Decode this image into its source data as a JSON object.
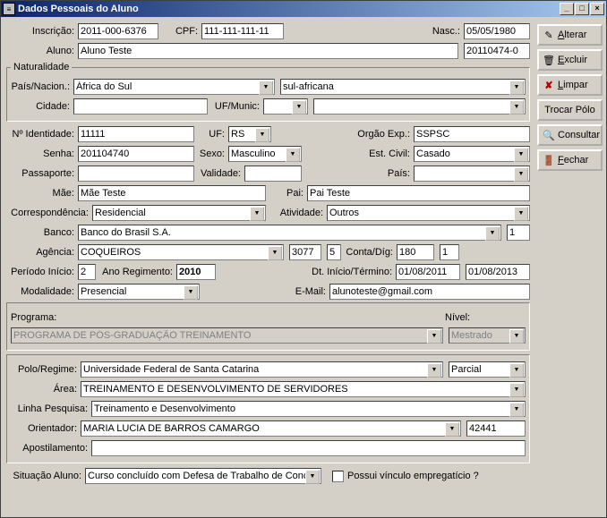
{
  "window": {
    "title": "Dados Pessoais do Aluno"
  },
  "buttons": {
    "alterar": "Alterar",
    "excluir": "Excluir",
    "limpar": "Limpar",
    "trocar_polo": "Trocar Pólo",
    "consultar": "Consultar",
    "fechar": "Fechar"
  },
  "labels": {
    "inscricao": "Inscrição:",
    "cpf": "CPF:",
    "nasc": "Nasc.:",
    "aluno": "Aluno:",
    "naturalidade_legend": "Naturalidade",
    "pais_nacion": "País/Nacion.:",
    "cidade": "Cidade:",
    "uf_munic": "UF/Munic:",
    "n_identidade": "Nº Identidade:",
    "uf": "UF:",
    "orgao_exp": "Orgão Exp.:",
    "senha": "Senha:",
    "sexo": "Sexo:",
    "est_civil": "Est. Civil:",
    "passaporte": "Passaporte:",
    "validade": "Validade:",
    "pais": "País:",
    "mae": "Mãe:",
    "pai": "Pai:",
    "correspondencia": "Correspondência:",
    "atividade": "Atividade:",
    "banco": "Banco:",
    "agencia": "Agência:",
    "conta_dig": "Conta/Díg:",
    "periodo_inicio": "Período Início:",
    "ano_regimento": "Ano Regimento:",
    "dt_inicio_termino": "Dt. Início/Término:",
    "modalidade": "Modalidade:",
    "email": "E-Mail:",
    "programa": "Programa:",
    "nivel": "Nível:",
    "polo_regime": "Polo/Regime:",
    "area": "Área:",
    "linha_pesquisa": "Linha Pesquisa:",
    "orientador": "Orientador:",
    "apostilamento": "Apostilamento:",
    "situacao_aluno": "Situação Aluno:",
    "possui_vinculo": "Possui vínculo empregatício ?"
  },
  "values": {
    "inscricao": "2011-000-6376",
    "cpf": "111-111-111-11",
    "nasc": "05/05/1980",
    "aluno": "Aluno Teste",
    "aluno_cod": "20110474-0",
    "pais": "África do Sul",
    "nacion": "sul-africana",
    "cidade": "",
    "uf_munic_uf": "",
    "uf_munic": "",
    "n_identidade": "11111",
    "uf": "RS",
    "orgao_exp": "SSPSC",
    "senha": "201104740",
    "sexo": "Masculino",
    "est_civil": "Casado",
    "passaporte": "",
    "validade": "",
    "pais_passaporte": "",
    "mae": "Mãe Teste",
    "pai": "Pai Teste",
    "correspondencia": "Residencial",
    "atividade": "Outros",
    "banco": "Banco do Brasil S.A.",
    "banco_cod": "1",
    "agencia": "COQUEIROS",
    "agencia_cod": "3077",
    "agencia_dig": "5",
    "conta": "180",
    "conta_dig": "1",
    "periodo_inicio": "2",
    "ano_regimento": "2010",
    "dt_inicio": "01/08/2011",
    "dt_termino": "01/08/2013",
    "modalidade": "Presencial",
    "email": "alunoteste@gmail.com",
    "programa": "PROGRAMA DE PÓS-GRADUAÇÃO TREINAMENTO",
    "nivel": "Mestrado",
    "polo": "Universidade Federal de Santa Catarina",
    "regime": "Parcial",
    "area": "TREINAMENTO E DESENVOLVIMENTO DE SERVIDORES",
    "linha_pesquisa": "Treinamento e Desenvolvimento",
    "orientador": "MARIA LUCIA DE BARROS CAMARGO",
    "orientador_cod": "42441",
    "apostilamento": "",
    "situacao_aluno": "Curso concluído com Defesa de Trabalho de Conclusã"
  }
}
